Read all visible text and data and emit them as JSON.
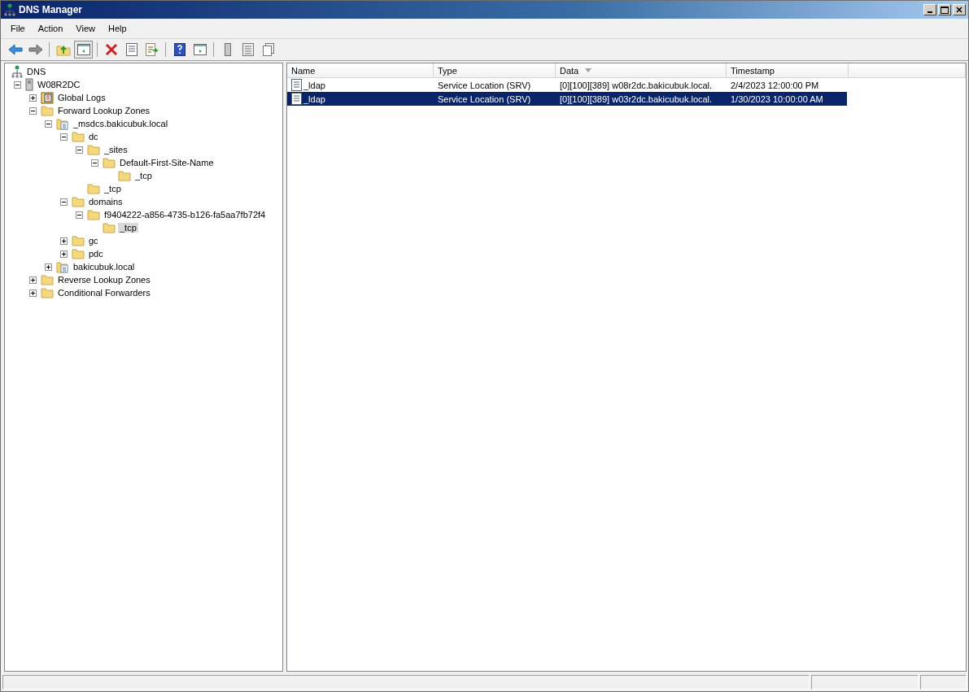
{
  "window": {
    "title": "DNS Manager"
  },
  "menu": [
    {
      "label": "File"
    },
    {
      "label": "Action"
    },
    {
      "label": "View"
    },
    {
      "label": "Help"
    }
  ],
  "toolbar": [
    {
      "kind": "back",
      "pressed": false
    },
    {
      "kind": "forward",
      "pressed": false
    },
    {
      "kind": "sep"
    },
    {
      "kind": "up",
      "pressed": false
    },
    {
      "kind": "tree",
      "pressed": true
    },
    {
      "kind": "sep"
    },
    {
      "kind": "delete",
      "pressed": false
    },
    {
      "kind": "properties",
      "pressed": false
    },
    {
      "kind": "export",
      "pressed": false
    },
    {
      "kind": "sep"
    },
    {
      "kind": "help",
      "pressed": false
    },
    {
      "kind": "pane",
      "pressed": false
    },
    {
      "kind": "sep"
    },
    {
      "kind": "server",
      "pressed": false
    },
    {
      "kind": "list",
      "pressed": false
    },
    {
      "kind": "copy",
      "pressed": false
    }
  ],
  "tree": {
    "label": "DNS",
    "kind": "dns",
    "selected": false,
    "children": [
      {
        "label": "W08R2DC",
        "kind": "server",
        "expanded": true,
        "selected": false,
        "children": [
          {
            "label": "Global Logs",
            "kind": "logs",
            "expanded": false,
            "selected": false
          },
          {
            "label": "Forward Lookup Zones",
            "kind": "folder",
            "expanded": true,
            "selected": false,
            "children": [
              {
                "label": "_msdcs.bakicubuk.local",
                "kind": "zone",
                "expanded": true,
                "selected": false,
                "children": [
                  {
                    "label": "dc",
                    "kind": "folder",
                    "expanded": true,
                    "selected": false,
                    "children": [
                      {
                        "label": "_sites",
                        "kind": "folder",
                        "expanded": true,
                        "selected": false,
                        "children": [
                          {
                            "label": "Default-First-Site-Name",
                            "kind": "folder",
                            "expanded": true,
                            "selected": false,
                            "children": [
                              {
                                "label": "_tcp",
                                "kind": "folder",
                                "selected": false
                              }
                            ]
                          }
                        ]
                      },
                      {
                        "label": "_tcp",
                        "kind": "folder",
                        "selected": false
                      }
                    ]
                  },
                  {
                    "label": "domains",
                    "kind": "folder",
                    "expanded": true,
                    "selected": false,
                    "children": [
                      {
                        "label": "f9404222-a856-4735-b126-fa5aa7fb72f4",
                        "kind": "folder",
                        "expanded": true,
                        "selected": false,
                        "children": [
                          {
                            "label": "_tcp",
                            "kind": "folder",
                            "selected": true
                          }
                        ]
                      }
                    ]
                  },
                  {
                    "label": "gc",
                    "kind": "folder",
                    "expanded": false,
                    "selected": false
                  },
                  {
                    "label": "pdc",
                    "kind": "folder",
                    "expanded": false,
                    "selected": false
                  }
                ]
              },
              {
                "label": "bakicubuk.local",
                "kind": "zone",
                "expanded": false,
                "selected": false
              }
            ]
          },
          {
            "label": "Reverse Lookup Zones",
            "kind": "folder",
            "expanded": false,
            "selected": false
          },
          {
            "label": "Conditional Forwarders",
            "kind": "folder",
            "expanded": false,
            "selected": false
          }
        ]
      }
    ]
  },
  "table": {
    "columns": [
      {
        "label": "Name",
        "sorted": false
      },
      {
        "label": "Type",
        "sorted": false
      },
      {
        "label": "Data",
        "sorted": true
      },
      {
        "label": "Timestamp",
        "sorted": false
      }
    ],
    "rows": [
      {
        "name": "_ldap",
        "type": "Service Location (SRV)",
        "data": "[0][100][389] w08r2dc.bakicubuk.local.",
        "timestamp": "2/4/2023 12:00:00 PM",
        "selected": false
      },
      {
        "name": "_ldap",
        "type": "Service Location (SRV)",
        "data": "[0][100][389] w03r2dc.bakicubuk.local.",
        "timestamp": "1/30/2023 10:00:00 AM",
        "selected": true
      }
    ]
  }
}
